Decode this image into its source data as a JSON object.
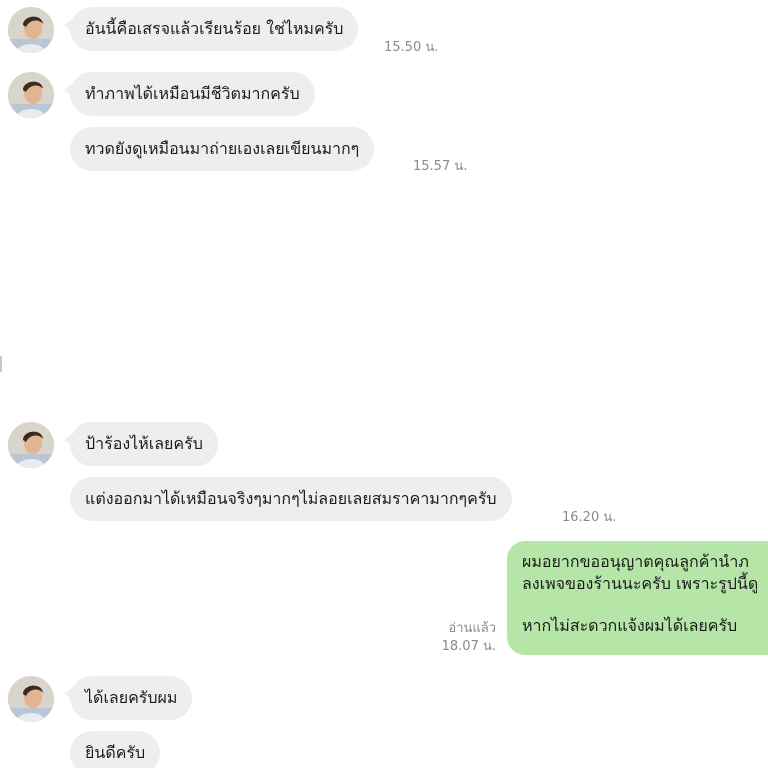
{
  "messages": [
    {
      "text": "อันนี้คือเสรจแล้วเรียนร้อย ใช่ไหมครับ",
      "time": "15.50 น."
    },
    {
      "text": "ทำภาพได้เหมือนมีชีวิตมากครับ"
    },
    {
      "text": "ทวดยังดูเหมือนมาถ่ายเองเลยเขียนมากๆ",
      "time": "15.57 น."
    },
    {
      "text": "ป้าร้องไห้เลยครับ"
    },
    {
      "text": "แต่งออกมาได้เหมือนจริงๆมากๆไม่ลอยเลยสมราคามากๆครับ",
      "time": "16.20 น."
    },
    {
      "text": "ได้เลยครับผม"
    },
    {
      "text": "ยินดีครับ"
    }
  ],
  "outgoing": {
    "line1": "ผมอยากขออนุญาตคุณลูกค้านำภ",
    "line2": "ลงเพจของร้านนะครับ เพราะรูปนี้ดู",
    "line3": "หากไม่สะดวกแจ้งผมได้เลยครับ",
    "read_label": "อ่านแล้ว",
    "time": "18.07 น."
  },
  "colors": {
    "incoming_bubble": "#eeeef0",
    "outgoing_bubble": "#b5e6a8",
    "timestamp": "#8a8a8a"
  },
  "icons": {
    "avatar": "contact-avatar-icon"
  }
}
